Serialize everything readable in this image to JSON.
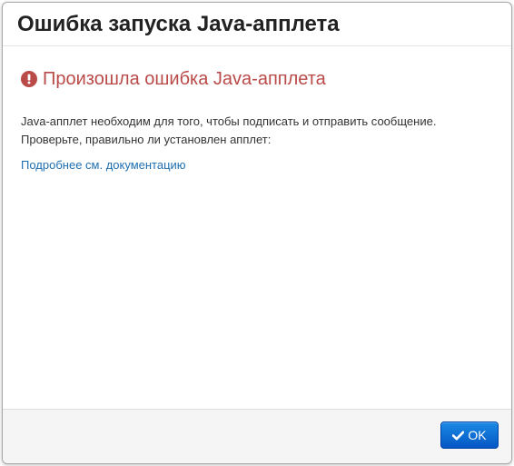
{
  "dialog": {
    "title": "Ошибка запуска Java-апплета",
    "error_heading": "Произошла ошибка Java-апплета",
    "message_line1": "Java-апплет необходим для того, чтобы подписать и отправить сообщение.",
    "message_line2": "Проверьте, правильно ли установлен апплет:",
    "doc_link": "Подробнее см. документацию",
    "ok_label": "OK"
  },
  "icons": {
    "error": "exclamation-circle-icon",
    "ok": "check-icon"
  },
  "colors": {
    "error_text": "#b94a48",
    "link": "#1f6fb2",
    "primary_button": "#0a6fd8"
  }
}
